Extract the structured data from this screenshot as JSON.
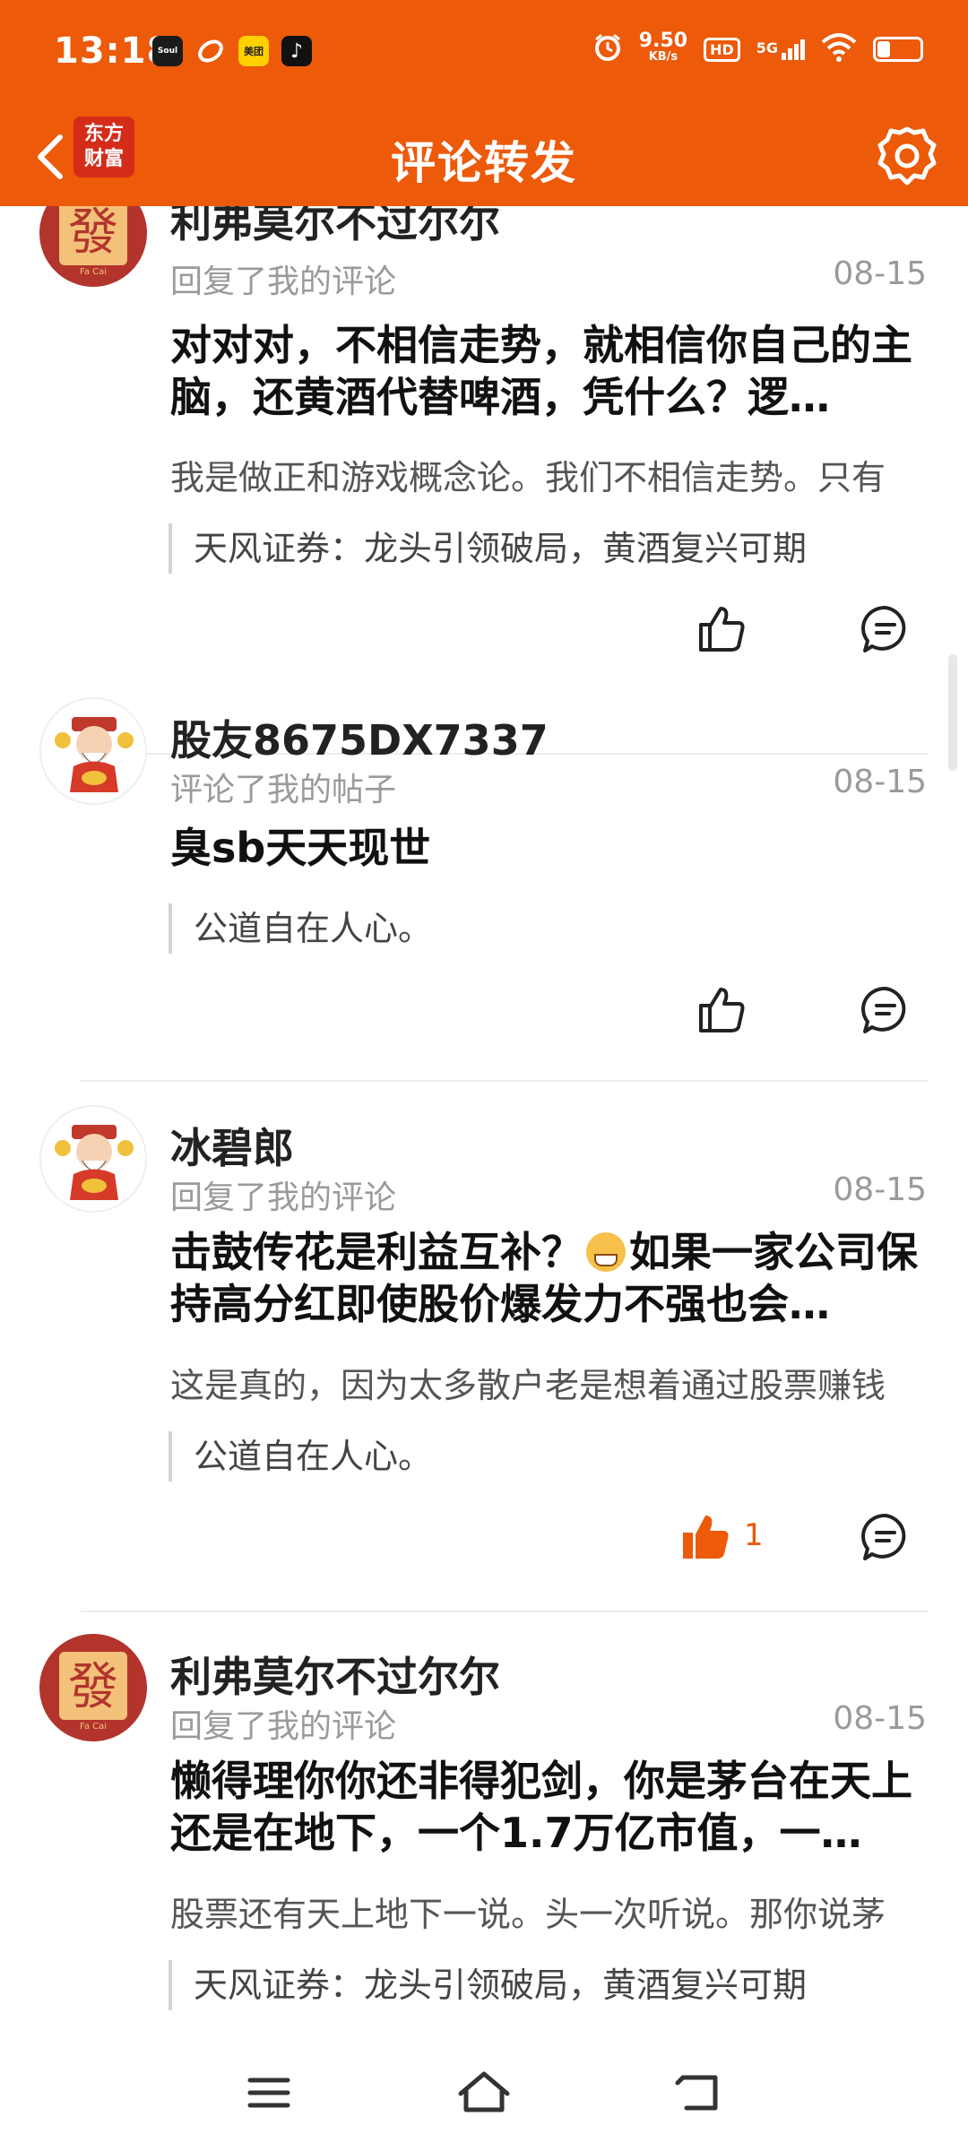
{
  "status_bar": {
    "time": "13:18",
    "net_speed_value": "9.50",
    "net_speed_unit": "KB/s",
    "hd": "HD",
    "network": "5G",
    "battery_level": 0.3,
    "app_icons": [
      {
        "name": "soul",
        "label": "Soul"
      },
      {
        "name": "meituan",
        "label": "美团"
      },
      {
        "name": "douyin",
        "label": "♪"
      }
    ]
  },
  "navbar": {
    "title": "评论转发",
    "logo_line1": "东方",
    "logo_line2": "财富",
    "back_icon": "chevron-left-icon",
    "settings_icon": "gear-icon"
  },
  "items": [
    {
      "user": "利弗莫尔不过尔尔",
      "action": "回复了我的评论",
      "date": "08-15",
      "main": "对对对，不相信走势，就相信你自己的主脑，还黄酒代替啤酒，凭什么？逻…",
      "sub": "我是做正和游戏概念论。我们不相信走势。只有",
      "quote": "天风证券：龙头引领破局，黄酒复兴可期",
      "likes": ""
    },
    {
      "user": "股友8675DX7337",
      "action": "评论了我的帖子",
      "date": "08-15",
      "main": "臭sb天天现世",
      "quote": "公道自在人心。",
      "likes": ""
    },
    {
      "user": "冰碧郎",
      "action": "回复了我的评论",
      "date": "08-15",
      "main_a": "击鼓传花是利益互补？",
      "main_b": "如果一家公司保持高分红即使股价爆发力不强也会…",
      "sub": "这是真的，因为太多散户老是想着通过股票赚钱",
      "quote": "公道自在人心。",
      "likes": "1"
    },
    {
      "user": "利弗莫尔不过尔尔",
      "action": "回复了我的评论",
      "date": "08-15",
      "main": "懒得理你你还非得犯剑，你是茅台在天上还是在地下，一个1.7万亿市值，一…",
      "sub": "股票还有天上地下一说。头一次听说。那你说茅",
      "quote": "天风证券：龙头引领破局，黄酒复兴可期"
    }
  ],
  "avatar_fa_text": "發",
  "avatar_fa_sub": "Fa Cai",
  "colors": {
    "brand": "#ec5a0a",
    "liked": "#ec5a0a"
  }
}
